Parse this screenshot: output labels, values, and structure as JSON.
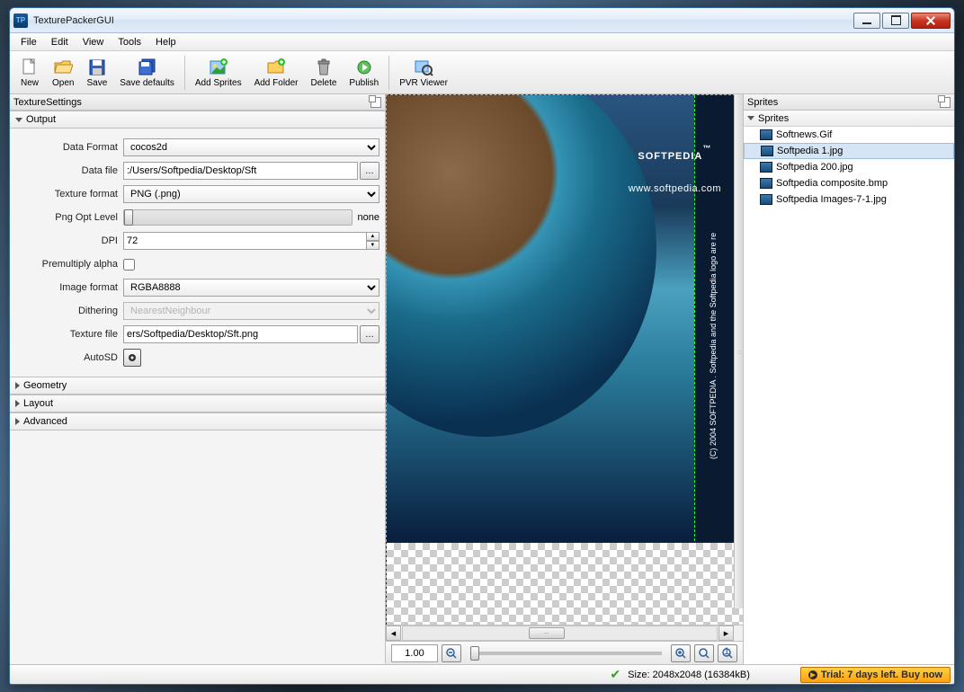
{
  "window": {
    "title": "TexturePackerGUI"
  },
  "menu": [
    "File",
    "Edit",
    "View",
    "Tools",
    "Help"
  ],
  "toolbar": [
    {
      "id": "new",
      "label": "New"
    },
    {
      "id": "open",
      "label": "Open"
    },
    {
      "id": "save",
      "label": "Save"
    },
    {
      "id": "save-defaults",
      "label": "Save defaults"
    },
    {
      "sep": true
    },
    {
      "id": "add-sprites",
      "label": "Add Sprites"
    },
    {
      "id": "add-folder",
      "label": "Add Folder"
    },
    {
      "id": "delete",
      "label": "Delete"
    },
    {
      "id": "publish",
      "label": "Publish"
    },
    {
      "sep": true
    },
    {
      "id": "pvr-viewer",
      "label": "PVR Viewer"
    }
  ],
  "left_panel": {
    "title": "TextureSettings",
    "sections": {
      "output": {
        "label": "Output",
        "fields": {
          "data_format": {
            "label": "Data Format",
            "value": "cocos2d"
          },
          "data_file": {
            "label": "Data file",
            "value": ":/Users/Softpedia/Desktop/Sft"
          },
          "texture_format": {
            "label": "Texture format",
            "value": "PNG (.png)"
          },
          "png_opt": {
            "label": "Png Opt Level",
            "value_text": "none"
          },
          "dpi": {
            "label": "DPI",
            "value": "72"
          },
          "premultiply": {
            "label": "Premultiply alpha"
          },
          "image_format": {
            "label": "Image format",
            "value": "RGBA8888"
          },
          "dithering": {
            "label": "Dithering",
            "value": "NearestNeighbour"
          },
          "texture_file": {
            "label": "Texture file",
            "value": "ers/Softpedia/Desktop/Sft.png"
          },
          "autosd": {
            "label": "AutoSD"
          }
        }
      },
      "geometry": {
        "label": "Geometry"
      },
      "layout": {
        "label": "Layout"
      },
      "advanced": {
        "label": "Advanced"
      }
    }
  },
  "right_panel": {
    "title": "Sprites",
    "header": "Sprites",
    "items": [
      "Softnews.Gif",
      "Softpedia 1.jpg",
      "Softpedia 200.jpg",
      "Softpedia composite.bmp",
      "Softpedia Images-7-1.jpg"
    ],
    "selected": 1
  },
  "canvas": {
    "logo": "SOFTPEDIA",
    "tm": "™",
    "url": "www.softpedia.com",
    "side_text": "(C) 2004  SOFTPEDIA . Softpedia and the Softpedia logo are re"
  },
  "zoom": {
    "value": "1.00"
  },
  "status": {
    "size_text": "Size: 2048x2048 (16384kB)",
    "trial_text": "Trial: 7 days left. Buy now"
  }
}
